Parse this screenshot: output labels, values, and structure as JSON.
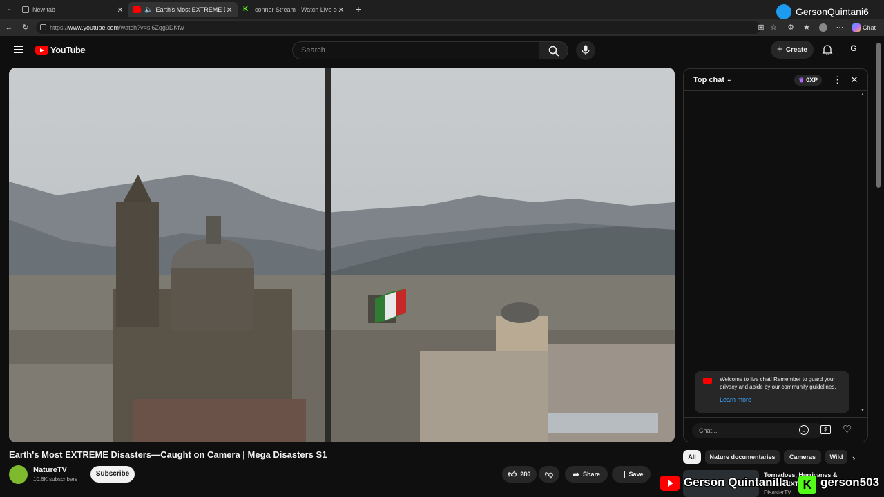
{
  "browser": {
    "tabs": [
      {
        "label": "New tab",
        "active": false
      },
      {
        "label": "Earth's Most EXTREME Disaste",
        "active": true
      },
      {
        "label": "conner Stream - Watch Live on Ki",
        "active": false
      }
    ],
    "url_prefix": "https://",
    "url_host": "www.youtube.com",
    "url_path": "/watch?v=si6Zqg9DKfw",
    "profile_name": "GersonQuintani6",
    "chat_label": "Chat"
  },
  "youtube": {
    "logo_text": "YouTube",
    "search_placeholder": "Search",
    "create_label": "Create",
    "avatar_letter": "G"
  },
  "chat": {
    "mode": "Top chat",
    "xp": "0XP",
    "notice_text": "Welcome to live chat! Remember to guard your privacy and abide by our community guidelines.",
    "learn_more": "Learn more",
    "input_placeholder": "Chat..."
  },
  "video": {
    "title": "Earth's Most EXTREME Disasters—Caught on Camera | Mega Disasters S1",
    "channel": "NatureTV",
    "subscribers": "10.6K subscribers",
    "subscribe_label": "Subscribe",
    "likes": "286",
    "share_label": "Share",
    "save_label": "Save"
  },
  "chips": [
    "All",
    "Nature documentaries",
    "Cameras",
    "Wild"
  ],
  "recommendation": {
    "title": "Tornadoes, Hurricanes & Earth's EXTR",
    "channel": "DisasterTV"
  },
  "overlay": {
    "name1": "Gerson Quintanilla",
    "name2": "gerson503"
  },
  "colors": {
    "youtube_red": "#ff0000",
    "link_blue": "#3ea6ff",
    "kick_green": "#53fc18",
    "twitter_blue": "#1d9bf0"
  }
}
